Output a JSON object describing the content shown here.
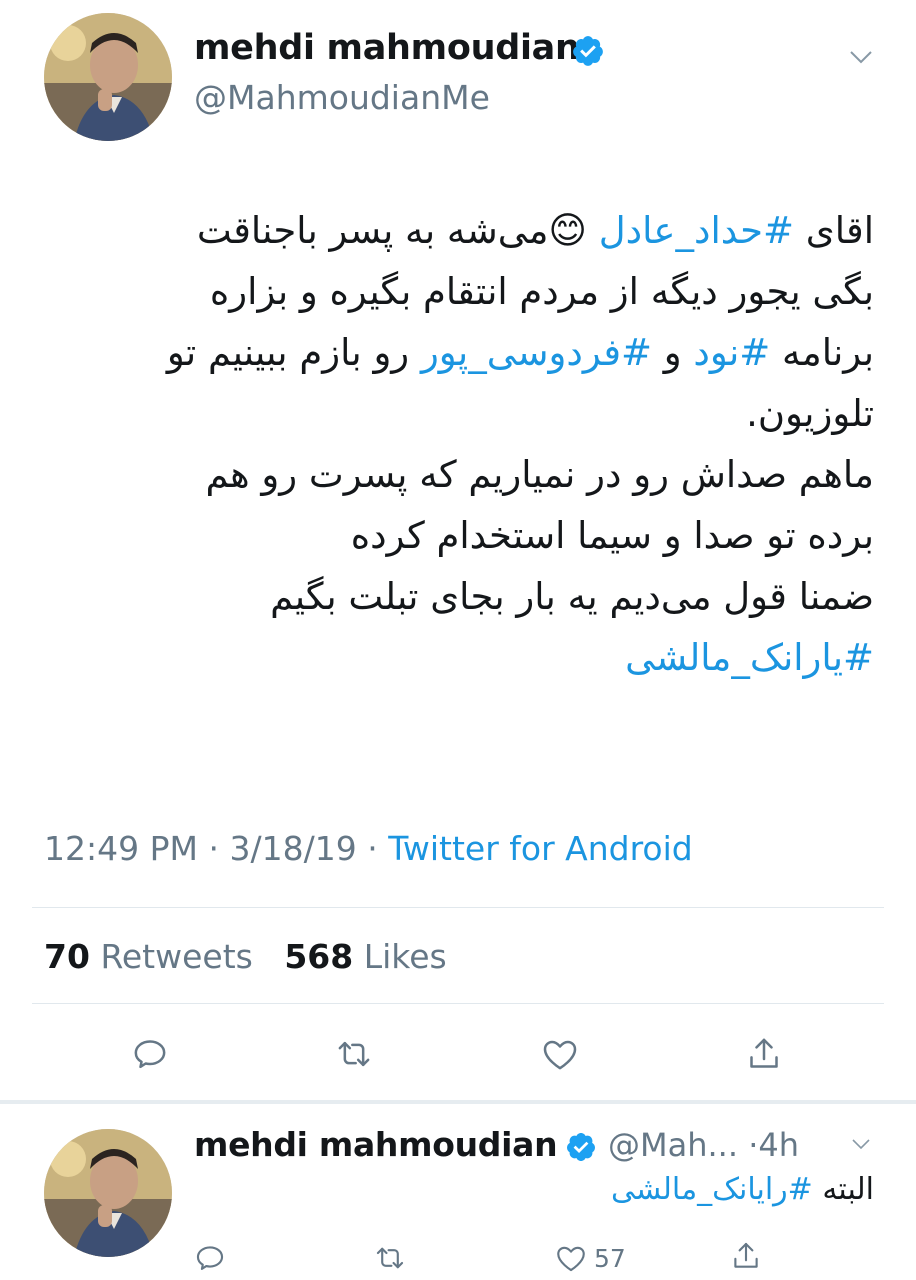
{
  "tweet": {
    "author_name": "mehdi mahmoudian",
    "author_handle": "@MahmoudianMe",
    "lines": [
      {
        "parts": [
          {
            "t": "اقای ",
            "h": false
          },
          {
            "t": "#حداد_عادل",
            "h": true
          },
          {
            "t": " 😊",
            "h": false
          },
          {
            "t": "می‌شه به پسر باجناقت",
            "h": false
          }
        ]
      },
      {
        "parts": [
          {
            "t": "بگی یجور دیگه از مردم انتقام بگیره و بزاره",
            "h": false
          }
        ]
      },
      {
        "parts": [
          {
            "t": "برنامه ",
            "h": false
          },
          {
            "t": "#نود",
            "h": true
          },
          {
            "t": " و ",
            "h": false
          },
          {
            "t": "#فردوسی_پور",
            "h": true
          },
          {
            "t": "  رو بازم ببینیم تو",
            "h": false
          }
        ]
      },
      {
        "parts": [
          {
            "t": "تلوزیون.",
            "h": false
          }
        ]
      },
      {
        "parts": [
          {
            "t": "ماهم صداش رو در نمیاریم که پسرت رو هم",
            "h": false
          }
        ]
      },
      {
        "parts": [
          {
            "t": "برده تو صدا و سیما استخدام کرده",
            "h": false
          }
        ]
      },
      {
        "parts": [
          {
            "t": "ضمنا قول می‌دیم یه بار بجای تبلت بگیم",
            "h": false
          }
        ]
      },
      {
        "parts": [
          {
            "t": "#یارانک_مالشی",
            "h": true
          }
        ]
      }
    ],
    "time": "12:49 PM",
    "dot1": "·",
    "date": "3/18/19",
    "dot2": "·",
    "source": "Twitter for Android",
    "retweets_count": "70",
    "retweets_label": "Retweets",
    "likes_count": "568",
    "likes_label": "Likes"
  },
  "reply": {
    "author_name": "mehdi mahmoudian",
    "author_handle": "@Mah...",
    "dot": "·",
    "time": "4h",
    "text_plain": "البته ",
    "text_hashtag": "#رایانک_مالشی",
    "like_count": "57"
  },
  "icons": {
    "verified": "verified-badge-icon",
    "chevron": "chevron-down-icon",
    "reply": "reply-icon",
    "retweet": "retweet-icon",
    "like": "heart-icon",
    "share": "share-icon"
  },
  "colors": {
    "link": "#1b95e0",
    "muted": "#657786",
    "text": "#14171a",
    "divider": "#e1e8ed",
    "verified": "#1da1f2"
  }
}
